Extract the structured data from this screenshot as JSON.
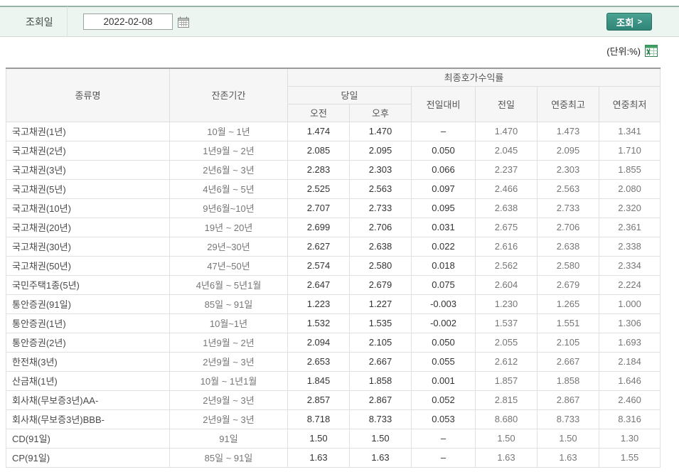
{
  "colors": {
    "up": "#c23a2e",
    "down": "#2f4f9e",
    "flat": "#333333",
    "accent": "#2f8577"
  },
  "toolbar": {
    "date_label": "조회일",
    "date_value": "2022-02-08",
    "search_button": "조회",
    "search_arrow": ">"
  },
  "meta": {
    "unit_label": "(단위:%)"
  },
  "table": {
    "header": {
      "col_type": "종류명",
      "col_period": "잔존기간",
      "col_yield_group": "최종호가수익률",
      "col_today": "당일",
      "col_am": "오전",
      "col_pm": "오후",
      "col_change": "전일대비",
      "col_prev": "전일",
      "col_high": "연중최고",
      "col_low": "연중최저"
    },
    "rows": [
      {
        "type": "국고채권(1년)",
        "period": "10월 ~ 1년",
        "am": "1.474",
        "am_dir": "up",
        "pm": "1.470",
        "pm_dir": "flat",
        "change": "–",
        "chg_dir": "flat",
        "prev": "1.470",
        "high": "1.473",
        "low": "1.341"
      },
      {
        "type": "국고채권(2년)",
        "period": "1년9월 ~ 2년",
        "am": "2.085",
        "am_dir": "up",
        "pm": "2.095",
        "pm_dir": "up",
        "change": "0.050",
        "chg_dir": "up",
        "prev": "2.045",
        "high": "2.095",
        "low": "1.710"
      },
      {
        "type": "국고채권(3년)",
        "period": "2년6월 ~ 3년",
        "am": "2.283",
        "am_dir": "up",
        "pm": "2.303",
        "pm_dir": "up",
        "change": "0.066",
        "chg_dir": "up",
        "prev": "2.237",
        "high": "2.303",
        "low": "1.855"
      },
      {
        "type": "국고채권(5년)",
        "period": "4년6월 ~ 5년",
        "am": "2.525",
        "am_dir": "up",
        "pm": "2.563",
        "pm_dir": "up",
        "change": "0.097",
        "chg_dir": "up",
        "prev": "2.466",
        "high": "2.563",
        "low": "2.080"
      },
      {
        "type": "국고채권(10년)",
        "period": "9년6월~10년",
        "am": "2.707",
        "am_dir": "up",
        "pm": "2.733",
        "pm_dir": "up",
        "change": "0.095",
        "chg_dir": "up",
        "prev": "2.638",
        "high": "2.733",
        "low": "2.320"
      },
      {
        "type": "국고채권(20년)",
        "period": "19년 ~ 20년",
        "am": "2.699",
        "am_dir": "up",
        "pm": "2.706",
        "pm_dir": "up",
        "change": "0.031",
        "chg_dir": "up",
        "prev": "2.675",
        "high": "2.706",
        "low": "2.361"
      },
      {
        "type": "국고채권(30년)",
        "period": "29년~30년",
        "am": "2.627",
        "am_dir": "up",
        "pm": "2.638",
        "pm_dir": "up",
        "change": "0.022",
        "chg_dir": "up",
        "prev": "2.616",
        "high": "2.638",
        "low": "2.338"
      },
      {
        "type": "국고채권(50년)",
        "period": "47년~50년",
        "am": "2.574",
        "am_dir": "up",
        "pm": "2.580",
        "pm_dir": "up",
        "change": "0.018",
        "chg_dir": "up",
        "prev": "2.562",
        "high": "2.580",
        "low": "2.334"
      },
      {
        "type": "국민주택1종(5년)",
        "period": "4년6월 ~ 5년1월",
        "am": "2.647",
        "am_dir": "up",
        "pm": "2.679",
        "pm_dir": "up",
        "change": "0.075",
        "chg_dir": "up",
        "prev": "2.604",
        "high": "2.679",
        "low": "2.224"
      },
      {
        "type": "통안증권(91일)",
        "period": "85일 ~ 91일",
        "am": "1.223",
        "am_dir": "down",
        "pm": "1.227",
        "pm_dir": "down",
        "change": "-0.003",
        "chg_dir": "down",
        "prev": "1.230",
        "high": "1.265",
        "low": "1.000"
      },
      {
        "type": "통안증권(1년)",
        "period": "10월~1년",
        "am": "1.532",
        "am_dir": "down",
        "pm": "1.535",
        "pm_dir": "down",
        "change": "-0.002",
        "chg_dir": "down",
        "prev": "1.537",
        "high": "1.551",
        "low": "1.306"
      },
      {
        "type": "통안증권(2년)",
        "period": "1년9월 ~ 2년",
        "am": "2.094",
        "am_dir": "up",
        "pm": "2.105",
        "pm_dir": "up",
        "change": "0.050",
        "chg_dir": "up",
        "prev": "2.055",
        "high": "2.105",
        "low": "1.693"
      },
      {
        "type": "한전채(3년)",
        "period": "2년9월 ~ 3년",
        "am": "2.653",
        "am_dir": "up",
        "pm": "2.667",
        "pm_dir": "up",
        "change": "0.055",
        "chg_dir": "up",
        "prev": "2.612",
        "high": "2.667",
        "low": "2.184"
      },
      {
        "type": "산금채(1년)",
        "period": "10월 ~ 1년1월",
        "am": "1.845",
        "am_dir": "down",
        "pm": "1.858",
        "pm_dir": "up",
        "change": "0.001",
        "chg_dir": "up",
        "prev": "1.857",
        "high": "1.858",
        "low": "1.646"
      },
      {
        "type": "회사채(무보증3년)AA-",
        "period": "2년9월 ~ 3년",
        "am": "2.857",
        "am_dir": "up",
        "pm": "2.867",
        "pm_dir": "up",
        "change": "0.052",
        "chg_dir": "up",
        "prev": "2.815",
        "high": "2.867",
        "low": "2.460"
      },
      {
        "type": "회사채(무보증3년)BBB-",
        "period": "2년9월 ~ 3년",
        "am": "8.718",
        "am_dir": "up",
        "pm": "8.733",
        "pm_dir": "up",
        "change": "0.053",
        "chg_dir": "up",
        "prev": "8.680",
        "high": "8.733",
        "low": "8.316"
      },
      {
        "type": "CD(91일)",
        "period": "91일",
        "am": "1.50",
        "am_dir": "flat",
        "pm": "1.50",
        "pm_dir": "flat",
        "change": "–",
        "chg_dir": "flat",
        "prev": "1.50",
        "high": "1.50",
        "low": "1.30"
      },
      {
        "type": "CP(91일)",
        "period": "85일 ~ 91일",
        "am": "1.63",
        "am_dir": "flat",
        "pm": "1.63",
        "pm_dir": "flat",
        "change": "–",
        "chg_dir": "flat",
        "prev": "1.63",
        "high": "1.63",
        "low": "1.55"
      }
    ]
  }
}
